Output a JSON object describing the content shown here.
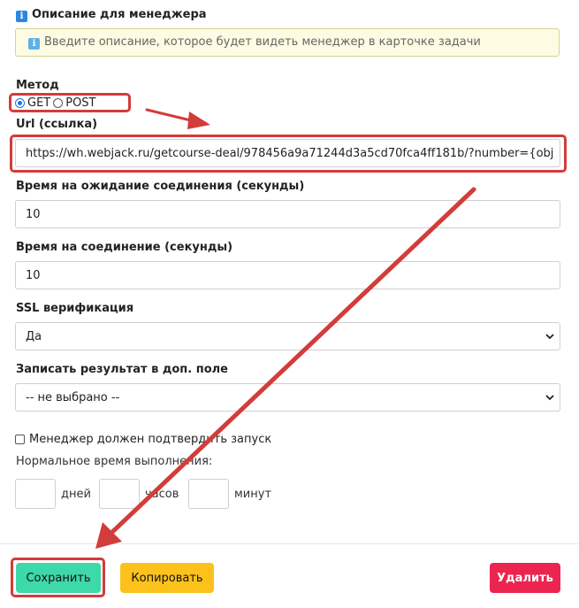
{
  "manager_section": {
    "title": "Описание для менеджера",
    "notice": "Введите описание, которое будет видеть менеджер в карточке задачи"
  },
  "method": {
    "label": "Метод",
    "options": [
      "GET",
      "POST"
    ],
    "selected": "GET"
  },
  "url": {
    "label": "Url (ссылка)",
    "value": "https://wh.webjack.ru/getcourse-deal/978456a9a71244d3a5cd70fca4ff181b/?number={obj"
  },
  "connect_wait": {
    "label": "Время на ожидание соединения (секунды)",
    "value": "10"
  },
  "connect_time": {
    "label": "Время на соединение (секунды)",
    "value": "10"
  },
  "ssl": {
    "label": "SSL верификация",
    "selected": "Да"
  },
  "result_field": {
    "label": "Записать результат в доп. поле",
    "selected": "-- не выбрано --"
  },
  "confirm": {
    "label": "Менеджер должен подтвердить запуск",
    "checked": false
  },
  "normal_time": {
    "label": "Нормальное время выполнения:",
    "days": "дней",
    "hours": "часов",
    "minutes": "минут"
  },
  "actions": {
    "save": "Сохранить",
    "copy": "Копировать",
    "delete": "Удалить"
  },
  "colors": {
    "save": "#3ed9a8",
    "copy": "#fcc21b",
    "delete": "#ec2450",
    "annotation": "#d23c3a"
  }
}
